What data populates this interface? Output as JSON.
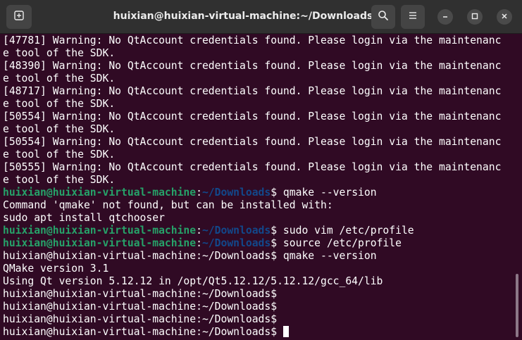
{
  "window": {
    "title": "huixian@huixian-virtual-machine:~/Downloads"
  },
  "icons": {
    "new_tab": "new-tab-icon",
    "search": "search-icon",
    "menu": "hamburger-menu-icon",
    "minimize": "minimize-icon",
    "maximize": "maximize-icon",
    "close": "close-icon"
  },
  "colors": {
    "terminal_background": "#300a24",
    "prompt_user": "#26a269",
    "prompt_path": "#12488b",
    "text": "#ffffff",
    "titlebar": "#303030"
  },
  "terminal": {
    "lines": [
      {
        "text": "[47781] Warning: No QtAccount credentials found. Please login via the maintenanc"
      },
      {
        "text": "e tool of the SDK."
      },
      {
        "text": "[48390] Warning: No QtAccount credentials found. Please login via the maintenanc"
      },
      {
        "text": "e tool of the SDK."
      },
      {
        "text": "[48717] Warning: No QtAccount credentials found. Please login via the maintenanc"
      },
      {
        "text": "e tool of the SDK."
      },
      {
        "text": "[50554] Warning: No QtAccount credentials found. Please login via the maintenanc"
      },
      {
        "text": "e tool of the SDK."
      },
      {
        "text": "[50554] Warning: No QtAccount credentials found. Please login via the maintenanc"
      },
      {
        "text": "e tool of the SDK."
      },
      {
        "text": "[50555] Warning: No QtAccount credentials found. Please login via the maintenanc"
      },
      {
        "text": "e tool of the SDK."
      },
      {
        "user": "huixian@huixian-virtual-machine",
        "sep": ":",
        "path": "~/Downloads",
        "cmd": "$ qmake --version"
      },
      {
        "text": "Command 'qmake' not found, but can be installed with:"
      },
      {
        "text": "sudo apt install qtchooser"
      },
      {
        "user": "huixian@huixian-virtual-machine",
        "sep": ":",
        "path": "~/Downloads",
        "cmd": "$ sudo vim /etc/profile"
      },
      {
        "user": "huixian@huixian-virtual-machine",
        "sep": ":",
        "path": "~/Downloads",
        "cmd": "$ source /etc/profile"
      },
      {
        "text": "huixian@huixian-virtual-machine:~/Downloads$ qmake --version"
      },
      {
        "text": "QMake version 3.1"
      },
      {
        "text": "Using Qt version 5.12.12 in /opt/Qt5.12.12/5.12.12/gcc_64/lib"
      },
      {
        "text": "huixian@huixian-virtual-machine:~/Downloads$"
      },
      {
        "text": "huixian@huixian-virtual-machine:~/Downloads$"
      },
      {
        "text": "huixian@huixian-virtual-machine:~/Downloads$"
      },
      {
        "text": "huixian@huixian-virtual-machine:~/Downloads$ ",
        "cursor": true
      }
    ]
  }
}
